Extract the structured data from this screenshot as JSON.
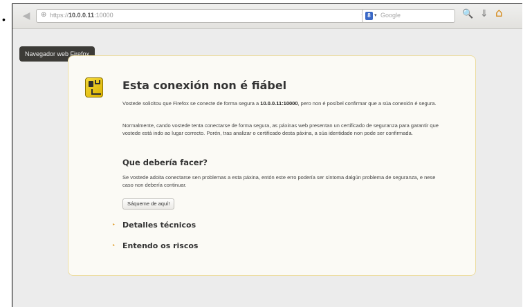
{
  "bullet": "•",
  "toolbar": {
    "back_icon": "◀",
    "url_scheme": "https://",
    "url_host": "10.0.0.11",
    "url_port": ":10000",
    "site_icon": "⊕",
    "star_icon": "☆",
    "dropmarker_icon": "▾",
    "reload_icon": "↻",
    "search_engine_letter": "8",
    "search_engine_drop": "▾",
    "search_placeholder": "Google",
    "search_icon": "🔍",
    "download_icon": "⇓",
    "home_icon": "⌂"
  },
  "tooltip": "Navegador web Firefox",
  "error_page": {
    "title": "Esta conexión non é fiábel",
    "p1_before": "Vostede solicitou que Firefox se conecte de forma segura a ",
    "p1_host": "10.0.0.11:10000",
    "p1_after": ", pero non é posíbel confirmar que a súa conexión é segura.",
    "p2": "Normalmente, cando vostede tenta conectarse de forma segura, as páxinas web presentan un certificado de seguranza para garantir que vostede está indo ao lugar correcto. Porén, tras analizar o certificado desta páxina, a súa identidade non pode ser confirmada.",
    "h2": "Que debería facer?",
    "p3": "Se vostede adoita conectarse sen problemas a esta páxina, entón este erro podería ser síntoma dalgún problema de seguranza, e nese caso non debería continuar.",
    "button": "Sáqueme de aquí!",
    "expander_icon": "▸",
    "technical_details": "Detalles técnicos",
    "understand_risks": "Entendo os riscos"
  }
}
